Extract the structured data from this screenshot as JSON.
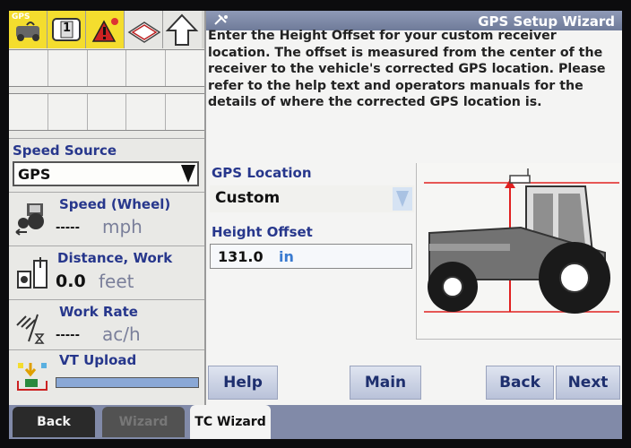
{
  "left_panel": {
    "gps_icon_text": "GPS",
    "slot_number": "1",
    "speed_source": {
      "label": "Speed Source",
      "value": "GPS"
    },
    "speed": {
      "label": "Speed (Wheel)",
      "value": "-----",
      "unit": "mph"
    },
    "distance": {
      "label": "Distance, Work",
      "value": "0.0",
      "unit": "feet"
    },
    "work_rate": {
      "label": "Work Rate",
      "value": "-----",
      "unit": "ac/h"
    },
    "vt_upload": {
      "label": "VT Upload",
      "progress": 1.0
    }
  },
  "wizard": {
    "title": "GPS Setup Wizard",
    "description": "Enter the Height Offset for your custom receiver location. The offset is measured from the center of the receiver to the vehicle's corrected GPS location. Please refer to the help text and operators manuals for the details of where the corrected GPS location is.",
    "gps_location": {
      "label": "GPS Location",
      "value": "Custom"
    },
    "height_offset": {
      "label": "Height Offset",
      "value": "131.0",
      "unit": "in"
    },
    "buttons": {
      "help": "Help",
      "main": "Main",
      "back": "Back",
      "next": "Next"
    }
  },
  "bottom_tabs": {
    "back": "Back",
    "wizard": "Wizard",
    "tc_wizard": "TC Wizard"
  },
  "colors": {
    "accent_blue": "#27378c",
    "titlebar": "#7c87a6",
    "indicator_yellow": "#f4dd2e",
    "guide_red": "#e02020"
  }
}
